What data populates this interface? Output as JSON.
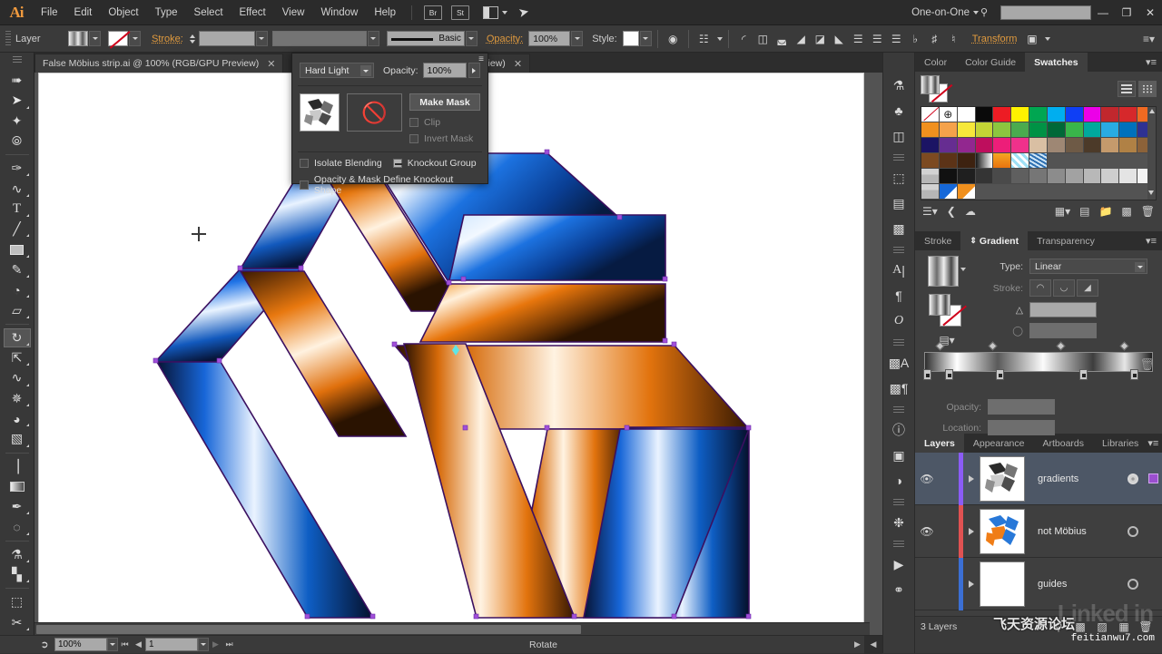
{
  "app": {
    "name": "Adobe Illustrator",
    "logo": "Ai",
    "workspace": "One-on-One",
    "search_placeholder": ""
  },
  "menubar": {
    "items": [
      "File",
      "Edit",
      "Object",
      "Type",
      "Select",
      "Effect",
      "View",
      "Window",
      "Help"
    ],
    "bridge_label": "Br",
    "stock_label": "St",
    "window_controls": {
      "minimize": "—",
      "restore": "❐",
      "close": "✕"
    }
  },
  "controlbar": {
    "context_label": "Layer",
    "stroke_label": "Stroke:",
    "stroke_weight": "",
    "profile_label": "",
    "brush_label": "Basic",
    "opacity_label": "Opacity:",
    "opacity_value": "100%",
    "style_label": "Style:",
    "transform_label": "Transform"
  },
  "tabs": [
    {
      "title": "False Möbius strip.ai @ 100% (RGB/GPU Preview)",
      "close": "✕",
      "active": true
    },
    {
      "title": "PU Preview)",
      "close": "✕",
      "active": false
    }
  ],
  "transparency_popup": {
    "blend_mode": "Hard Light",
    "opacity_label": "Opacity:",
    "opacity_value": "100%",
    "make_mask_label": "Make Mask",
    "clip_label": "Clip",
    "invert_mask_label": "Invert Mask",
    "isolate_blending_label": "Isolate Blending",
    "knockout_group_label": "Knockout Group",
    "knockout_shape_label": "Opacity & Mask Define Knockout Shape",
    "clip_checked": false,
    "invert_checked": false,
    "isolate_checked": false,
    "knockout_state": "neutral"
  },
  "toolbar": {
    "tools": [
      {
        "name": "selection-tool",
        "glyph": "➤"
      },
      {
        "name": "direct-selection-tool",
        "glyph": "➤"
      },
      {
        "name": "magic-wand-tool",
        "glyph": "✦"
      },
      {
        "name": "lasso-tool",
        "glyph": "❦"
      },
      {
        "name": "pen-tool",
        "glyph": "✑"
      },
      {
        "name": "curvature-tool",
        "glyph": "∿"
      },
      {
        "name": "type-tool",
        "glyph": "T"
      },
      {
        "name": "line-segment-tool",
        "glyph": "╱"
      },
      {
        "name": "rectangle-tool",
        "glyph": "▭"
      },
      {
        "name": "paintbrush-tool",
        "glyph": "✎"
      },
      {
        "name": "shaper-tool",
        "glyph": "◔"
      },
      {
        "name": "eraser-tool",
        "glyph": "▱"
      },
      {
        "name": "rotate-tool",
        "glyph": "↻"
      },
      {
        "name": "scale-tool",
        "glyph": "⤡"
      },
      {
        "name": "width-tool",
        "glyph": "∿"
      },
      {
        "name": "free-transform-tool",
        "glyph": "✥"
      },
      {
        "name": "shape-builder-tool",
        "glyph": "◑"
      },
      {
        "name": "perspective-grid-tool",
        "glyph": "◧"
      },
      {
        "name": "mesh-tool",
        "glyph": "⌗"
      },
      {
        "name": "gradient-tool",
        "glyph": "▤"
      },
      {
        "name": "eyedropper-tool",
        "glyph": "✒"
      },
      {
        "name": "blend-tool",
        "glyph": "◌"
      },
      {
        "name": "symbol-sprayer-tool",
        "glyph": "⚘"
      },
      {
        "name": "column-graph-tool",
        "glyph": "█"
      },
      {
        "name": "artboard-tool",
        "glyph": "⬚"
      },
      {
        "name": "slice-tool",
        "glyph": "✄"
      },
      {
        "name": "hand-tool",
        "glyph": "✋"
      }
    ]
  },
  "icondock": {
    "icons": [
      {
        "name": "brushes-icon",
        "glyph": "⚘"
      },
      {
        "name": "symbols-icon",
        "glyph": "♣"
      },
      {
        "name": "pathfinder-icon",
        "glyph": "◰"
      },
      {
        "name": "transform-icon",
        "glyph": "⬚"
      },
      {
        "name": "align-icon",
        "glyph": "☰"
      },
      {
        "name": "pathfinder2-icon",
        "glyph": "◱"
      },
      {
        "name": "character-icon",
        "glyph": "A"
      },
      {
        "name": "paragraph-icon",
        "glyph": "¶"
      },
      {
        "name": "opentype-icon",
        "glyph": "O"
      },
      {
        "name": "character-styles-icon",
        "glyph": "Ⓐ"
      },
      {
        "name": "paragraph-styles-icon",
        "glyph": "¶"
      },
      {
        "name": "info-icon",
        "glyph": "ⓘ"
      },
      {
        "name": "document-info-icon",
        "glyph": "ⓘ"
      },
      {
        "name": "separation-preview-icon",
        "glyph": "◕"
      },
      {
        "name": "navigator-icon",
        "glyph": "❁"
      },
      {
        "name": "actions-icon",
        "glyph": "▶"
      },
      {
        "name": "links-icon",
        "glyph": "⚭"
      }
    ]
  },
  "panels": {
    "top_group": {
      "tabs": [
        "Color",
        "Color Guide",
        "Swatches"
      ],
      "active": "Swatches"
    },
    "swatches": {
      "rows": [
        [
          "none",
          "registration",
          "#ffffff",
          "#0a0a0a",
          "#ed1c24",
          "#fff200",
          "#00a651",
          "#00aeef",
          "#0f3ff5",
          "#ec00e8",
          "#c1272d",
          "#d6282b",
          "#f06a22"
        ],
        [
          "#f0901e",
          "#f5a24a",
          "#f6e83a",
          "#c3d435",
          "#8cc63f",
          "#4bab4e",
          "#009245",
          "#006837",
          "#39b54a",
          "#00a99d",
          "#29abe2",
          "#0071bc",
          "#2e3192"
        ],
        [
          "#1b1464",
          "#662d91",
          "#92278f",
          "#be0e5d",
          "#ed1e79",
          "#f0318b",
          "#d9bfa3",
          "#9e8774",
          "#6e5a46",
          "#4c3a29",
          "#c49a6c",
          "#b08145",
          "#8c6239"
        ],
        [
          "#7c4a21",
          "#5c3317",
          "#3d2210",
          "gradient-bw",
          "gradient-orange",
          "pattern-blue",
          "pattern-texture",
          "",
          "",
          "",
          "",
          "",
          ""
        ],
        [
          "folder",
          "#111111",
          "#1f1f1f",
          "#343434",
          "#4a4a4a",
          "#5f5f5f",
          "#767676",
          "#8c8c8c",
          "#a2a2a2",
          "#b8b8b8",
          "#cecece",
          "#e4e4e4",
          "#f3f3f3"
        ],
        [
          "folder",
          "swatch-blue-corner",
          "swatch-orange-corner",
          "",
          "",
          "",
          "",
          "",
          "",
          "",
          "",
          "",
          ""
        ]
      ],
      "footer_icons": [
        "libraries-icon",
        "color-link-icon",
        "cloud-icon",
        "show-kind-icon",
        "new-group-icon",
        "folder-icon",
        "new-swatch-icon",
        "delete-icon"
      ]
    },
    "middle_group": {
      "tabs": [
        "Stroke",
        "Gradient",
        "Transparency"
      ],
      "active": "Gradient"
    },
    "gradient": {
      "type_label": "Type:",
      "type_value": "Linear",
      "stroke_label": "Stroke:",
      "angle_label": "",
      "aspect_label": "",
      "opacity_label": "Opacity:",
      "opacity_value": "",
      "location_label": "Location:",
      "location_value": "",
      "stops": [
        {
          "position": 0,
          "color": "#2e2e2e"
        },
        {
          "position": 10,
          "color": "#ffffff"
        },
        {
          "position": 34,
          "color": "#f4f4f4"
        },
        {
          "position": 68,
          "color": "#6a6a6a"
        },
        {
          "position": 97,
          "color": "#1a1a1a"
        }
      ],
      "midpoints": [
        4,
        22,
        50,
        78
      ]
    },
    "bottom_group": {
      "tabs": [
        "Layers",
        "Appearance",
        "Artboards",
        "Libraries"
      ],
      "active": "Layers"
    },
    "layers": {
      "rows": [
        {
          "name": "gradients",
          "color": "#8b5cf6",
          "visible": true,
          "selected": true,
          "targeted": true,
          "has_selection": true,
          "thumb": "gradients-thumb"
        },
        {
          "name": "not Möbius",
          "color": "#e05252",
          "visible": true,
          "selected": false,
          "targeted": false,
          "has_selection": false,
          "thumb": "mobius-thumb"
        },
        {
          "name": "guides",
          "color": "#3b6fd4",
          "visible": false,
          "selected": false,
          "targeted": false,
          "has_selection": false,
          "thumb": "blank-thumb"
        }
      ],
      "count_label": "3 Layers",
      "footer_icons": [
        "locate-object-icon",
        "make-clipping-mask-icon",
        "create-sublayer-icon",
        "new-layer-icon",
        "delete-layer-icon"
      ]
    }
  },
  "statusbar": {
    "share_icon": "share-icon",
    "zoom_value": "100%",
    "artboard_value": "1",
    "status_text": "Rotate"
  },
  "canvas": {
    "document_name": "False Möbius strip.ai",
    "zoom": "100%",
    "color_mode": "RGB/GPU Preview",
    "artwork_title": "False Möbius strip",
    "anchor_color": "#9b4fd0",
    "blue_gradient": [
      "#0a1c4a",
      "#1f6fe0",
      "#e8f2ff",
      "#1360c8",
      "#071436"
    ],
    "orange_gradient": [
      "#3a1a02",
      "#e8730f",
      "#fff0dc",
      "#e0700c",
      "#2a1301"
    ]
  },
  "watermarks": {
    "linkedin": "Linked in",
    "chinese": "飞天资源论坛",
    "url": "feitianwu7.com"
  }
}
